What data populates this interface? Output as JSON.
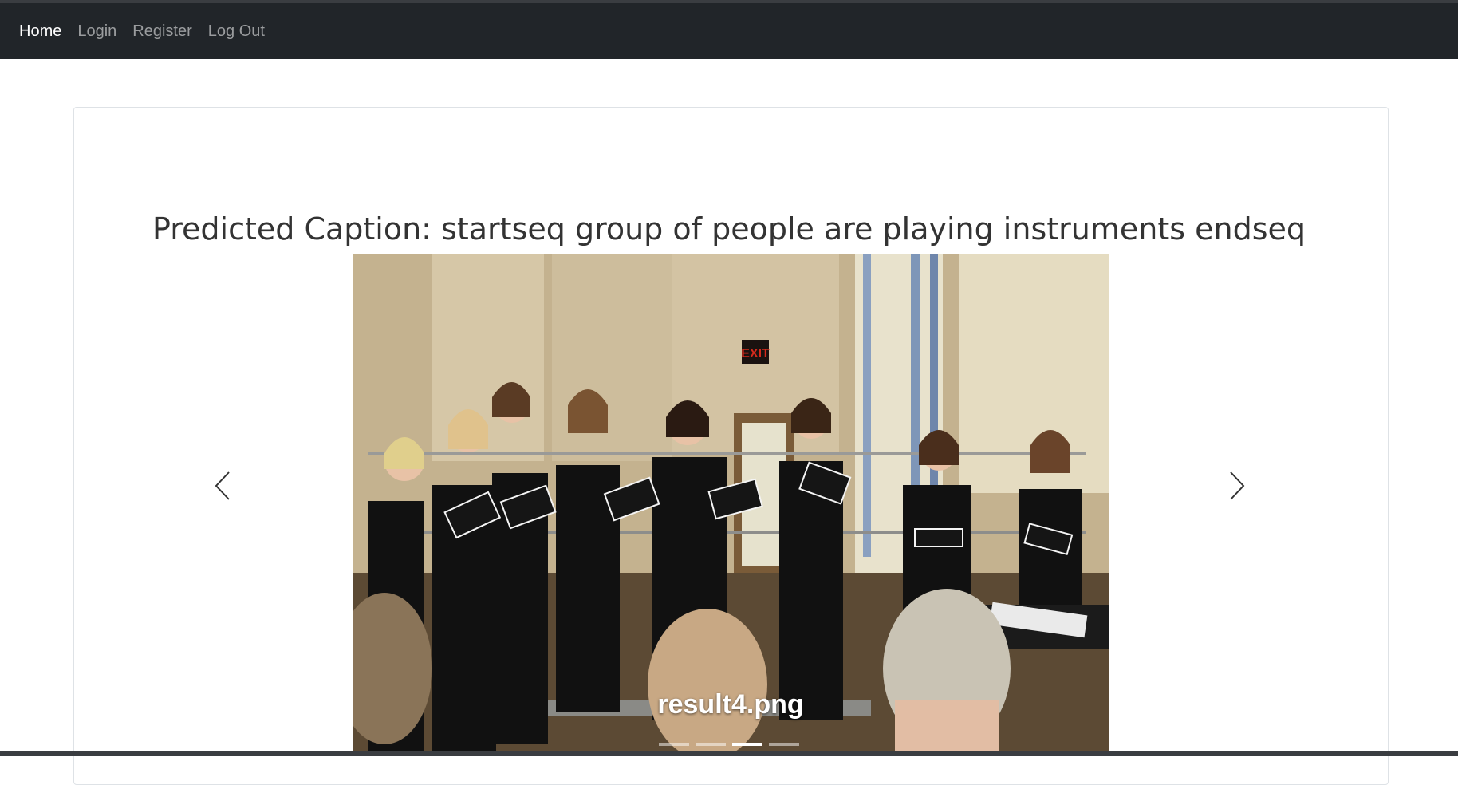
{
  "nav": {
    "items": [
      {
        "label": "Home",
        "active": true
      },
      {
        "label": "Login",
        "active": false
      },
      {
        "label": "Register",
        "active": false
      },
      {
        "label": "Log Out",
        "active": false
      }
    ]
  },
  "main": {
    "caption_title": "Predicted Caption: startseq group of people are playing instruments endseq"
  },
  "carousel": {
    "slide_caption": "result4.png",
    "exit_sign": "EXIT",
    "active_index": 3,
    "indicator_count": 4,
    "prev_icon": "chevron-left-icon",
    "next_icon": "chevron-right-icon"
  },
  "colors": {
    "navbar_bg": "#212529",
    "nav_active": "#ffffff",
    "nav_inactive": "rgba(255,255,255,0.55)"
  }
}
